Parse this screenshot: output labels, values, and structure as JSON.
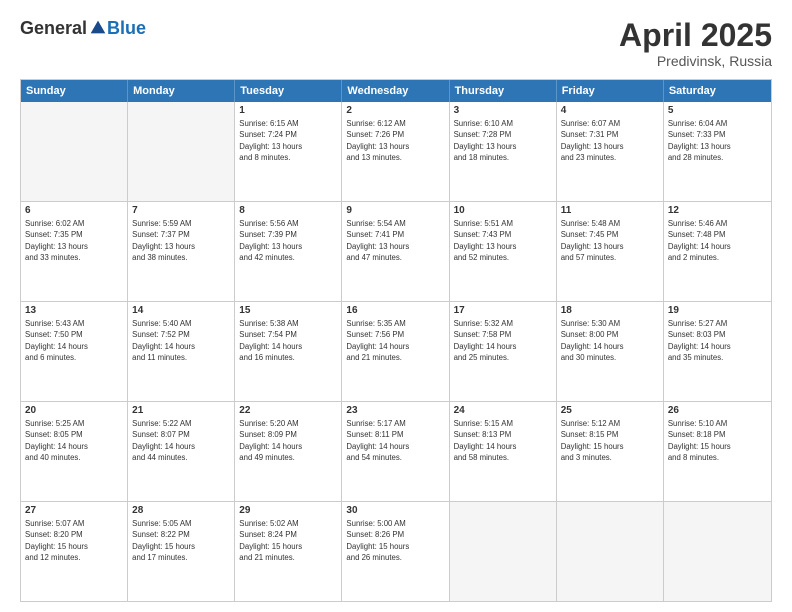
{
  "header": {
    "logo_general": "General",
    "logo_blue": "Blue",
    "month_title": "April 2025",
    "subtitle": "Predivinsk, Russia"
  },
  "days_of_week": [
    "Sunday",
    "Monday",
    "Tuesday",
    "Wednesday",
    "Thursday",
    "Friday",
    "Saturday"
  ],
  "rows": [
    [
      {
        "day": "",
        "empty": true,
        "lines": []
      },
      {
        "day": "",
        "empty": true,
        "lines": []
      },
      {
        "day": "1",
        "empty": false,
        "lines": [
          "Sunrise: 6:15 AM",
          "Sunset: 7:24 PM",
          "Daylight: 13 hours",
          "and 8 minutes."
        ]
      },
      {
        "day": "2",
        "empty": false,
        "lines": [
          "Sunrise: 6:12 AM",
          "Sunset: 7:26 PM",
          "Daylight: 13 hours",
          "and 13 minutes."
        ]
      },
      {
        "day": "3",
        "empty": false,
        "lines": [
          "Sunrise: 6:10 AM",
          "Sunset: 7:28 PM",
          "Daylight: 13 hours",
          "and 18 minutes."
        ]
      },
      {
        "day": "4",
        "empty": false,
        "lines": [
          "Sunrise: 6:07 AM",
          "Sunset: 7:31 PM",
          "Daylight: 13 hours",
          "and 23 minutes."
        ]
      },
      {
        "day": "5",
        "empty": false,
        "lines": [
          "Sunrise: 6:04 AM",
          "Sunset: 7:33 PM",
          "Daylight: 13 hours",
          "and 28 minutes."
        ]
      }
    ],
    [
      {
        "day": "6",
        "empty": false,
        "lines": [
          "Sunrise: 6:02 AM",
          "Sunset: 7:35 PM",
          "Daylight: 13 hours",
          "and 33 minutes."
        ]
      },
      {
        "day": "7",
        "empty": false,
        "lines": [
          "Sunrise: 5:59 AM",
          "Sunset: 7:37 PM",
          "Daylight: 13 hours",
          "and 38 minutes."
        ]
      },
      {
        "day": "8",
        "empty": false,
        "lines": [
          "Sunrise: 5:56 AM",
          "Sunset: 7:39 PM",
          "Daylight: 13 hours",
          "and 42 minutes."
        ]
      },
      {
        "day": "9",
        "empty": false,
        "lines": [
          "Sunrise: 5:54 AM",
          "Sunset: 7:41 PM",
          "Daylight: 13 hours",
          "and 47 minutes."
        ]
      },
      {
        "day": "10",
        "empty": false,
        "lines": [
          "Sunrise: 5:51 AM",
          "Sunset: 7:43 PM",
          "Daylight: 13 hours",
          "and 52 minutes."
        ]
      },
      {
        "day": "11",
        "empty": false,
        "lines": [
          "Sunrise: 5:48 AM",
          "Sunset: 7:45 PM",
          "Daylight: 13 hours",
          "and 57 minutes."
        ]
      },
      {
        "day": "12",
        "empty": false,
        "lines": [
          "Sunrise: 5:46 AM",
          "Sunset: 7:48 PM",
          "Daylight: 14 hours",
          "and 2 minutes."
        ]
      }
    ],
    [
      {
        "day": "13",
        "empty": false,
        "lines": [
          "Sunrise: 5:43 AM",
          "Sunset: 7:50 PM",
          "Daylight: 14 hours",
          "and 6 minutes."
        ]
      },
      {
        "day": "14",
        "empty": false,
        "lines": [
          "Sunrise: 5:40 AM",
          "Sunset: 7:52 PM",
          "Daylight: 14 hours",
          "and 11 minutes."
        ]
      },
      {
        "day": "15",
        "empty": false,
        "lines": [
          "Sunrise: 5:38 AM",
          "Sunset: 7:54 PM",
          "Daylight: 14 hours",
          "and 16 minutes."
        ]
      },
      {
        "day": "16",
        "empty": false,
        "lines": [
          "Sunrise: 5:35 AM",
          "Sunset: 7:56 PM",
          "Daylight: 14 hours",
          "and 21 minutes."
        ]
      },
      {
        "day": "17",
        "empty": false,
        "lines": [
          "Sunrise: 5:32 AM",
          "Sunset: 7:58 PM",
          "Daylight: 14 hours",
          "and 25 minutes."
        ]
      },
      {
        "day": "18",
        "empty": false,
        "lines": [
          "Sunrise: 5:30 AM",
          "Sunset: 8:00 PM",
          "Daylight: 14 hours",
          "and 30 minutes."
        ]
      },
      {
        "day": "19",
        "empty": false,
        "lines": [
          "Sunrise: 5:27 AM",
          "Sunset: 8:03 PM",
          "Daylight: 14 hours",
          "and 35 minutes."
        ]
      }
    ],
    [
      {
        "day": "20",
        "empty": false,
        "lines": [
          "Sunrise: 5:25 AM",
          "Sunset: 8:05 PM",
          "Daylight: 14 hours",
          "and 40 minutes."
        ]
      },
      {
        "day": "21",
        "empty": false,
        "lines": [
          "Sunrise: 5:22 AM",
          "Sunset: 8:07 PM",
          "Daylight: 14 hours",
          "and 44 minutes."
        ]
      },
      {
        "day": "22",
        "empty": false,
        "lines": [
          "Sunrise: 5:20 AM",
          "Sunset: 8:09 PM",
          "Daylight: 14 hours",
          "and 49 minutes."
        ]
      },
      {
        "day": "23",
        "empty": false,
        "lines": [
          "Sunrise: 5:17 AM",
          "Sunset: 8:11 PM",
          "Daylight: 14 hours",
          "and 54 minutes."
        ]
      },
      {
        "day": "24",
        "empty": false,
        "lines": [
          "Sunrise: 5:15 AM",
          "Sunset: 8:13 PM",
          "Daylight: 14 hours",
          "and 58 minutes."
        ]
      },
      {
        "day": "25",
        "empty": false,
        "lines": [
          "Sunrise: 5:12 AM",
          "Sunset: 8:15 PM",
          "Daylight: 15 hours",
          "and 3 minutes."
        ]
      },
      {
        "day": "26",
        "empty": false,
        "lines": [
          "Sunrise: 5:10 AM",
          "Sunset: 8:18 PM",
          "Daylight: 15 hours",
          "and 8 minutes."
        ]
      }
    ],
    [
      {
        "day": "27",
        "empty": false,
        "lines": [
          "Sunrise: 5:07 AM",
          "Sunset: 8:20 PM",
          "Daylight: 15 hours",
          "and 12 minutes."
        ]
      },
      {
        "day": "28",
        "empty": false,
        "lines": [
          "Sunrise: 5:05 AM",
          "Sunset: 8:22 PM",
          "Daylight: 15 hours",
          "and 17 minutes."
        ]
      },
      {
        "day": "29",
        "empty": false,
        "lines": [
          "Sunrise: 5:02 AM",
          "Sunset: 8:24 PM",
          "Daylight: 15 hours",
          "and 21 minutes."
        ]
      },
      {
        "day": "30",
        "empty": false,
        "lines": [
          "Sunrise: 5:00 AM",
          "Sunset: 8:26 PM",
          "Daylight: 15 hours",
          "and 26 minutes."
        ]
      },
      {
        "day": "",
        "empty": true,
        "lines": []
      },
      {
        "day": "",
        "empty": true,
        "lines": []
      },
      {
        "day": "",
        "empty": true,
        "lines": []
      }
    ]
  ]
}
